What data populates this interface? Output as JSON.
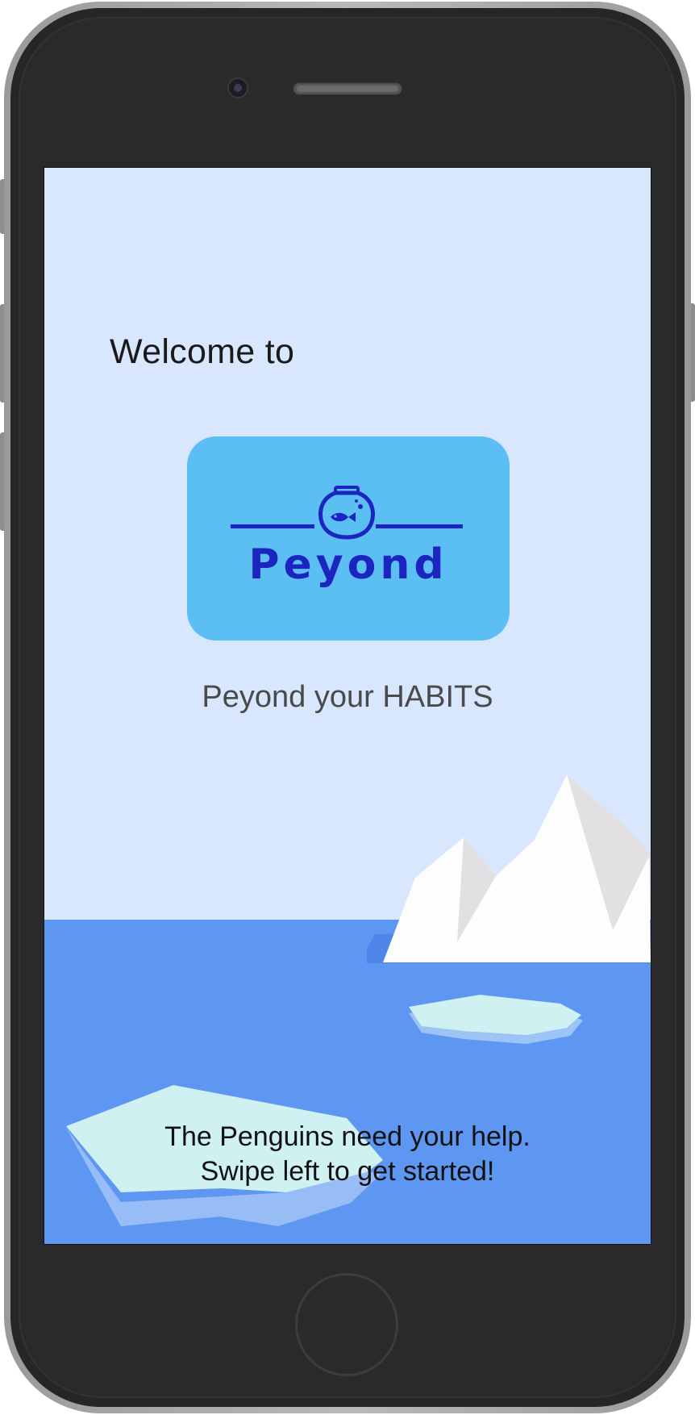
{
  "welcome_text": "Welcome to",
  "logo": {
    "brand_name": "Peyond",
    "icon": "fishbowl-icon"
  },
  "tagline": "Peyond your HABITS",
  "cta": {
    "line1": "The Penguins need your help.",
    "line2": "Swipe left to get started!"
  },
  "colors": {
    "sky": "#d8e6fe",
    "ocean": "#5d97f2",
    "logo_bg": "#5bbff3",
    "logo_fg": "#1d25c1",
    "ice": "#cff1f2"
  }
}
